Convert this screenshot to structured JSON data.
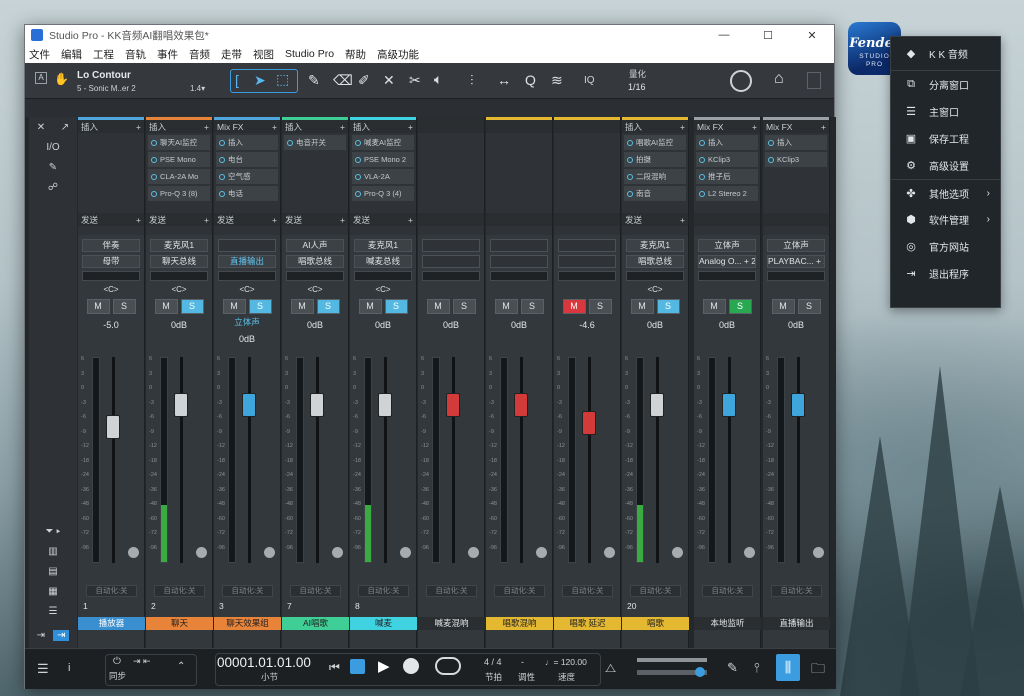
{
  "window": {
    "title": "Studio Pro - KK音频AI翻唱效果包*",
    "controls": {
      "minimize": "—",
      "maximize": "☐",
      "close": "✕"
    }
  },
  "menu": [
    "文件",
    "编辑",
    "工程",
    "音轨",
    "事件",
    "音频",
    "走带",
    "视图",
    "Studio Pro",
    "帮助",
    "高级功能"
  ],
  "toolbar": {
    "track_name": "Lo Contour",
    "track_sub": "5 - Sonic M..er 2",
    "version": "1.4▾",
    "quantize_label": "量化",
    "quantize_value": "1/16",
    "iq": "IQ"
  },
  "left_panel": {
    "io": "I/O"
  },
  "channels": [
    {
      "color": "#4ea8dd",
      "insert_head": "插入",
      "inserts": [],
      "send_head": "发送",
      "in": "伴奏",
      "out": "母带",
      "out_blue": false,
      "pan": "<C>",
      "ms": [
        "M",
        "S"
      ],
      "ms_state": [
        "",
        ""
      ],
      "extra": "",
      "vol": "-5.0",
      "num": "1",
      "name": "播放器",
      "name_bg": "#3a8fd1",
      "name_color": "#fff",
      "meter": 0,
      "capcolor": "#cfd3d6",
      "fader": 0.32
    },
    {
      "color": "#e8833a",
      "insert_head": "插入",
      "inserts": [
        "聊天AI监控",
        "PSE Mono",
        "CLA-2A Mo",
        "Pro-Q 3 (8)"
      ],
      "send_head": "发送",
      "in": "麦克风1",
      "out": "聊天总线",
      "out_blue": false,
      "pan": "<C>",
      "ms": [
        "M",
        "S"
      ],
      "ms_state": [
        "",
        "blue"
      ],
      "extra": "",
      "vol": "0dB",
      "num": "2",
      "name": "聊天",
      "name_bg": "#e8833a",
      "name_color": "#222",
      "meter": 0.28,
      "capcolor": "#cfd3d6",
      "fader": 0.2
    },
    {
      "color": "#4ea8dd",
      "insert_head": "Mix FX",
      "inserts": [
        "插入",
        "电台",
        "空气感",
        "电话"
      ],
      "send_head": "发送",
      "in": "",
      "out": "直播输出",
      "out_blue": true,
      "pan": "<C>",
      "ms": [
        "M",
        "S"
      ],
      "ms_state": [
        "",
        "blue"
      ],
      "extra": "立体声",
      "vol": "0dB",
      "num": "3",
      "name": "聊天效果组",
      "name_bg": "#e8833a",
      "name_color": "#222",
      "meter": 0,
      "capcolor": "#3fa6dc",
      "fader": 0.2
    },
    {
      "color": "#3fcf96",
      "insert_head": "插入",
      "inserts": [
        "电音开关"
      ],
      "send_head": "发送",
      "in": "AI人声",
      "out": "唱歌总线",
      "out_blue": false,
      "pan": "<C>",
      "ms": [
        "M",
        "S"
      ],
      "ms_state": [
        "",
        "blue"
      ],
      "extra": "",
      "vol": "0dB",
      "num": "7",
      "name": "AI唱歌",
      "name_bg": "#3fcf96",
      "name_color": "#222",
      "meter": 0,
      "capcolor": "#cfd3d6",
      "fader": 0.2
    },
    {
      "color": "#3fd2e0",
      "insert_head": "插入",
      "inserts": [
        "喊麦AI监控",
        "PSE Mono 2",
        "VLA-2A",
        "Pro-Q 3 (4)"
      ],
      "send_head": "发送",
      "in": "麦克风1",
      "out": "喊麦总线",
      "out_blue": false,
      "pan": "<C>",
      "ms": [
        "M",
        "S"
      ],
      "ms_state": [
        "",
        "blue"
      ],
      "extra": "",
      "vol": "0dB",
      "num": "8",
      "name": "喊麦",
      "name_bg": "#3fd2e0",
      "name_color": "#222",
      "meter": 0.28,
      "capcolor": "#cfd3d6",
      "fader": 0.2
    },
    {
      "color": "#2a2e31",
      "insert_head": "",
      "inserts": [],
      "send_head": "",
      "in": "",
      "out": "",
      "out_blue": false,
      "pan": "",
      "ms": [
        "M",
        "S"
      ],
      "ms_state": [
        "",
        ""
      ],
      "extra": "",
      "vol": "0dB",
      "num": "",
      "name": "喊麦混响",
      "name_bg": "#2a2e31",
      "name_color": "#e2e6e8",
      "meter": 0,
      "capcolor": "#d33a3a",
      "fader": 0.2
    },
    {
      "color": "#e5b831",
      "insert_head": "",
      "inserts": [],
      "send_head": "",
      "in": "",
      "out": "",
      "out_blue": false,
      "pan": "",
      "ms": [
        "M",
        "S"
      ],
      "ms_state": [
        "",
        ""
      ],
      "extra": "",
      "vol": "0dB",
      "num": "",
      "name": "唱歌混响",
      "name_bg": "#e5b831",
      "name_color": "#222",
      "meter": 0,
      "capcolor": "#d33a3a",
      "fader": 0.2
    },
    {
      "color": "#e5b831",
      "insert_head": "",
      "inserts": [],
      "send_head": "",
      "in": "",
      "out": "",
      "out_blue": false,
      "pan": "",
      "ms": [
        "M",
        "S"
      ],
      "ms_state": [
        "red",
        ""
      ],
      "extra": "",
      "vol": "-4.6",
      "num": "",
      "name": "唱歌 延迟",
      "name_bg": "#e5b831",
      "name_color": "#222",
      "meter": 0,
      "capcolor": "#d33a3a",
      "fader": 0.3
    },
    {
      "color": "#e5b831",
      "insert_head": "插入",
      "inserts": [
        "唱歌AI监控",
        "拍摄",
        "二段混响",
        "南音"
      ],
      "send_head": "发送",
      "in": "麦克风1",
      "out": "唱歌总线",
      "out_blue": false,
      "pan": "<C>",
      "ms": [
        "M",
        "S"
      ],
      "ms_state": [
        "",
        "blue"
      ],
      "extra": "",
      "vol": "0dB",
      "num": "20",
      "name": "唱歌",
      "name_bg": "#e5b831",
      "name_color": "#222",
      "meter": 0.28,
      "capcolor": "#cfd3d6",
      "fader": 0.2
    },
    {
      "color": "#9aa0a5",
      "insert_head": "Mix FX",
      "inserts": [
        "插入",
        "KClip3",
        "推子后",
        "L2 Stereo 2"
      ],
      "send_head": "",
      "in": "立体声",
      "out": "Analog O... + 2",
      "out_blue": false,
      "pan": "",
      "ms": [
        "M",
        "S"
      ],
      "ms_state": [
        "",
        "green"
      ],
      "extra": "",
      "vol": "0dB",
      "num": "",
      "name": "本地监听",
      "name_bg": "#2a2e31",
      "name_color": "#e2e6e8",
      "meter": 0,
      "capcolor": "#3fa6dc",
      "fader": 0.2
    },
    {
      "color": "#9aa0a5",
      "insert_head": "Mix FX",
      "inserts": [
        "插入",
        "KClip3"
      ],
      "send_head": "",
      "in": "立体声",
      "out": "PLAYBAC... + 2",
      "out_blue": false,
      "pan": "",
      "ms": [
        "M",
        "S"
      ],
      "ms_state": [
        "",
        ""
      ],
      "extra": "",
      "vol": "0dB",
      "num": "",
      "name": "直播输出",
      "name_bg": "#2a2e31",
      "name_color": "#e2e6e8",
      "meter": 0,
      "capcolor": "#3fa6dc",
      "fader": 0.2
    }
  ],
  "scale_marks": [
    "6",
    "3",
    "0",
    "-3",
    "-6",
    "-9",
    "-12",
    "-18",
    "-24",
    "-36",
    "-48",
    "-60",
    "-72",
    "-96"
  ],
  "automation_label": "自动化:关",
  "transport": {
    "position": "00001.01.01.00",
    "unit": "小节",
    "signature": "4 / 4",
    "signature_label": "节拍",
    "key_label": "调性",
    "tempo": "♩= 120.00",
    "tempo_label": "速度",
    "sync_label": "同步"
  },
  "popup": {
    "items": [
      {
        "icon": "◆",
        "label": "K K 音频",
        "arrow": ""
      },
      {
        "icon": "⧉",
        "label": "分离窗口",
        "arrow": ""
      },
      {
        "icon": "☰",
        "label": "主窗口",
        "arrow": ""
      },
      {
        "icon": "▣",
        "label": "保存工程",
        "arrow": ""
      },
      {
        "icon": "⚙",
        "label": "高级设置",
        "arrow": ""
      },
      {
        "icon": "✤",
        "label": "其他选项",
        "arrow": "›"
      },
      {
        "icon": "⬢",
        "label": "软件管理",
        "arrow": "›"
      },
      {
        "icon": "◎",
        "label": "官方网站",
        "arrow": ""
      },
      {
        "icon": "⇥",
        "label": "退出程序",
        "arrow": ""
      }
    ]
  },
  "badge": {
    "brand": "Fender",
    "line1": "STUDIO",
    "line2": "PRO"
  }
}
